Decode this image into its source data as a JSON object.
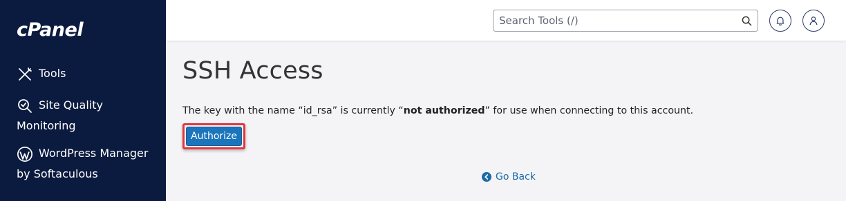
{
  "sidebar": {
    "logo": "cPanel",
    "items": [
      {
        "label": "Tools",
        "icon": "tools-icon"
      },
      {
        "label_line1": "Site Quality",
        "label_line2": "Monitoring",
        "icon": "site-quality-icon"
      },
      {
        "label_line1": "WordPress Manager",
        "label_line2": "by Softaculous",
        "icon": "wordpress-icon"
      }
    ]
  },
  "header": {
    "search_placeholder": "Search Tools (/)"
  },
  "main": {
    "title": "SSH Access",
    "message_prefix": "The key with the name “id_rsa” is currently “",
    "message_status": "not authorized",
    "message_suffix": "” for use when connecting to this account.",
    "authorize_label": "Authorize",
    "go_back_label": "Go Back"
  },
  "colors": {
    "sidebar_bg": "#0b1b3f",
    "primary_button": "#1b75bc",
    "highlight_border": "#e0373f",
    "link": "#1b6aa5"
  }
}
